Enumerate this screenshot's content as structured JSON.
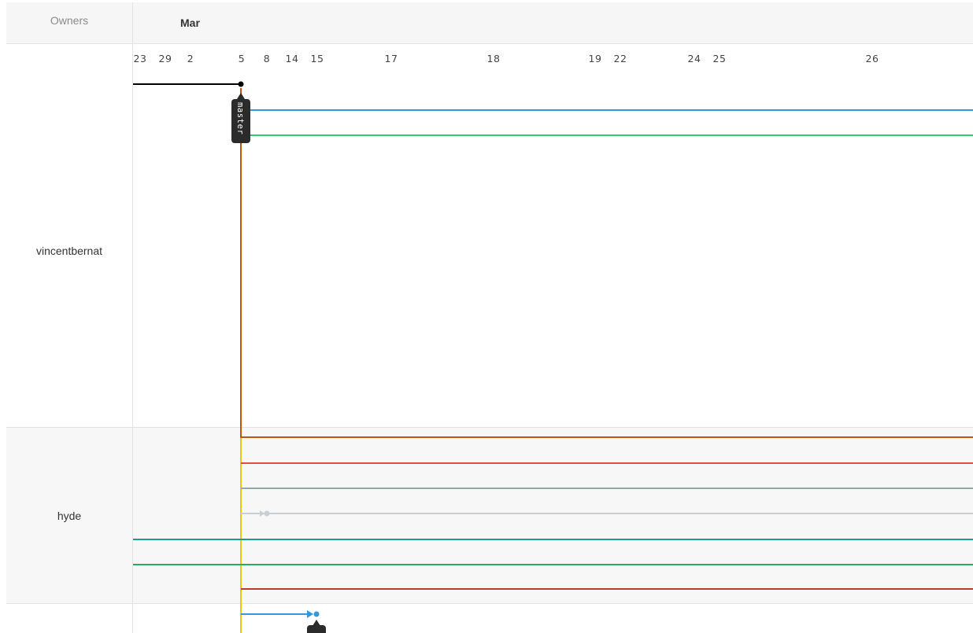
{
  "header": {
    "owners_title": "Owners",
    "month_label": "Mar"
  },
  "timeline": {
    "date_ticks": [
      "23",
      "29",
      "2",
      "5",
      "8",
      "14",
      "15",
      "17",
      "18",
      "19",
      "22",
      "24",
      "25",
      "26"
    ]
  },
  "owners": [
    {
      "name": "vincentbernat"
    },
    {
      "name": "hyde"
    },
    {
      "name": ""
    }
  ],
  "branch_tags": {
    "master": "master"
  },
  "colors": {
    "black": "#000000",
    "blue": "#3498db",
    "green": "#2ecc71",
    "brown": "#c0560e",
    "yellow": "#f1c40f",
    "red": "#e74c3c",
    "slate": "#95a5a6",
    "light_gray": "#bdc3c7",
    "teal": "#16a085",
    "green2": "#27ae60",
    "dark_red": "#c0392b"
  }
}
